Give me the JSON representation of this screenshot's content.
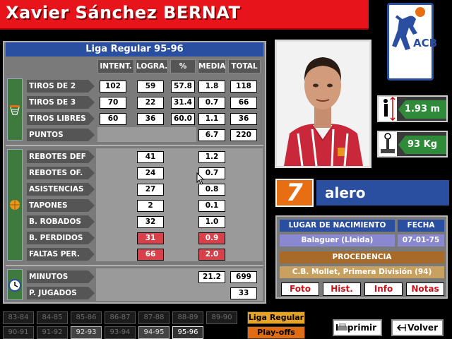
{
  "player": {
    "name": "Xavier Sánchez BERNAT"
  },
  "season": {
    "title": "Liga Regular 95-96"
  },
  "columns": [
    "INTENT.",
    "LOGRA.",
    "%",
    "MEDIA",
    "TOTAL"
  ],
  "shooting_rows": [
    {
      "label": "TIROS DE 2",
      "values": [
        "102",
        "59",
        "57.8",
        "1.8",
        "118"
      ]
    },
    {
      "label": "TIROS DE 3",
      "values": [
        "70",
        "22",
        "31.4",
        "0.7",
        "66"
      ]
    },
    {
      "label": "TIROS LIBRES",
      "values": [
        "60",
        "36",
        "60.0",
        "1.1",
        "36"
      ]
    },
    {
      "label": "PUNTOS",
      "values": [
        "",
        "",
        "",
        "6.7",
        "220"
      ]
    }
  ],
  "other_rows": [
    {
      "label": "REBOTES DEF",
      "logra": "41",
      "media": "1.2"
    },
    {
      "label": "REBOTES OF.",
      "logra": "24",
      "media": "0.7"
    },
    {
      "label": "ASISTENCIAS",
      "logra": "27",
      "media": "0.8"
    },
    {
      "label": "TAPONES",
      "logra": "2",
      "media": "0.1"
    },
    {
      "label": "B. ROBADOS",
      "logra": "32",
      "media": "1.0"
    },
    {
      "label": "B. PERDIDOS",
      "logra": "31",
      "media": "0.9"
    },
    {
      "label": "FALTAS PER.",
      "logra": "66",
      "media": "2.0"
    }
  ],
  "time_rows": [
    {
      "label": "MINUTOS",
      "media": "21.2",
      "total": "699"
    },
    {
      "label": "P. JUGADOS",
      "media": "",
      "total": "33"
    }
  ],
  "physical": {
    "height": "1.93 m",
    "weight": "93 Kg"
  },
  "jersey": {
    "number": "7",
    "position": "alero"
  },
  "bio": {
    "birthplace_label": "LUGAR DE NACIMIENTO",
    "date_label": "FECHA",
    "birthplace": "Balaguer (Lleida)",
    "date": "07-01-75",
    "origin_label": "PROCEDENCIA",
    "origin": "C.B. Mollet, Primera División (94)"
  },
  "bio_buttons": [
    "Foto",
    "Hist.",
    "Info",
    "Notas"
  ],
  "seasons_row1": [
    "83-84",
    "84-85",
    "85-86",
    "86-87",
    "87-88",
    "88-89",
    "89-90"
  ],
  "seasons_row2": [
    "90-91",
    "91-92",
    "92-93",
    "93-94",
    "94-95",
    "95-96"
  ],
  "toggles": {
    "regular": "Liga Regular",
    "playoffs": "Play-offs"
  },
  "actions": {
    "print": "Imprimir",
    "back": "Volver"
  },
  "logo_text": "ACB",
  "colors": {
    "accent_red": "#e8141c",
    "header_blue": "#2a4ea0",
    "jersey_orange": "#e86e14",
    "stat_green": "#2f8a3a"
  }
}
